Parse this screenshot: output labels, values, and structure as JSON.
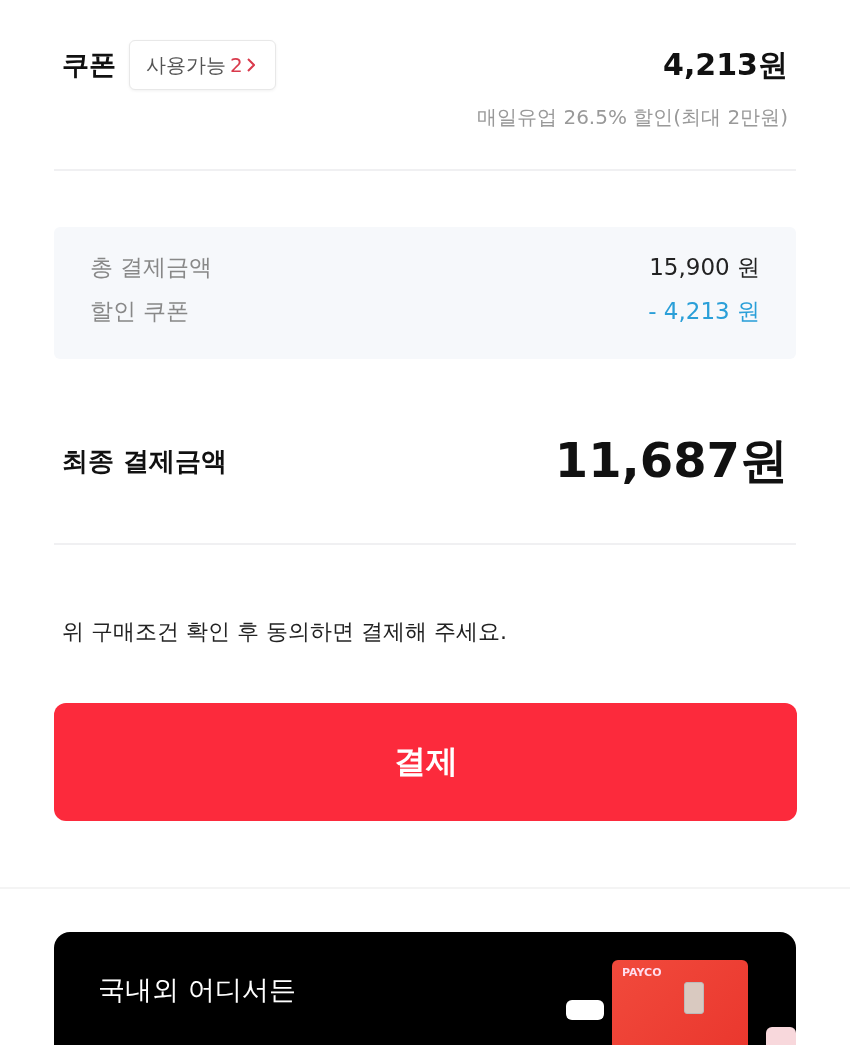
{
  "coupon": {
    "label": "쿠폰",
    "badge_text": "사용가능",
    "badge_count": "2",
    "amount": "4,213원",
    "note": "매일유업 26.5% 할인(최대 2만원)"
  },
  "summary": [
    {
      "kind": "normal",
      "label": "총 결제금액",
      "value": "15,900 원"
    },
    {
      "kind": "discount",
      "label": "할인 쿠폰",
      "value": "- 4,213 원"
    }
  ],
  "final": {
    "label": "최종 결제금액",
    "amount": "11,687원"
  },
  "notice": "위 구매조건 확인 후 동의하면 결제해 주세요.",
  "pay_button": "결제",
  "banner": {
    "headline": "국내외 어디서든",
    "card_brand": "PAYCO"
  }
}
